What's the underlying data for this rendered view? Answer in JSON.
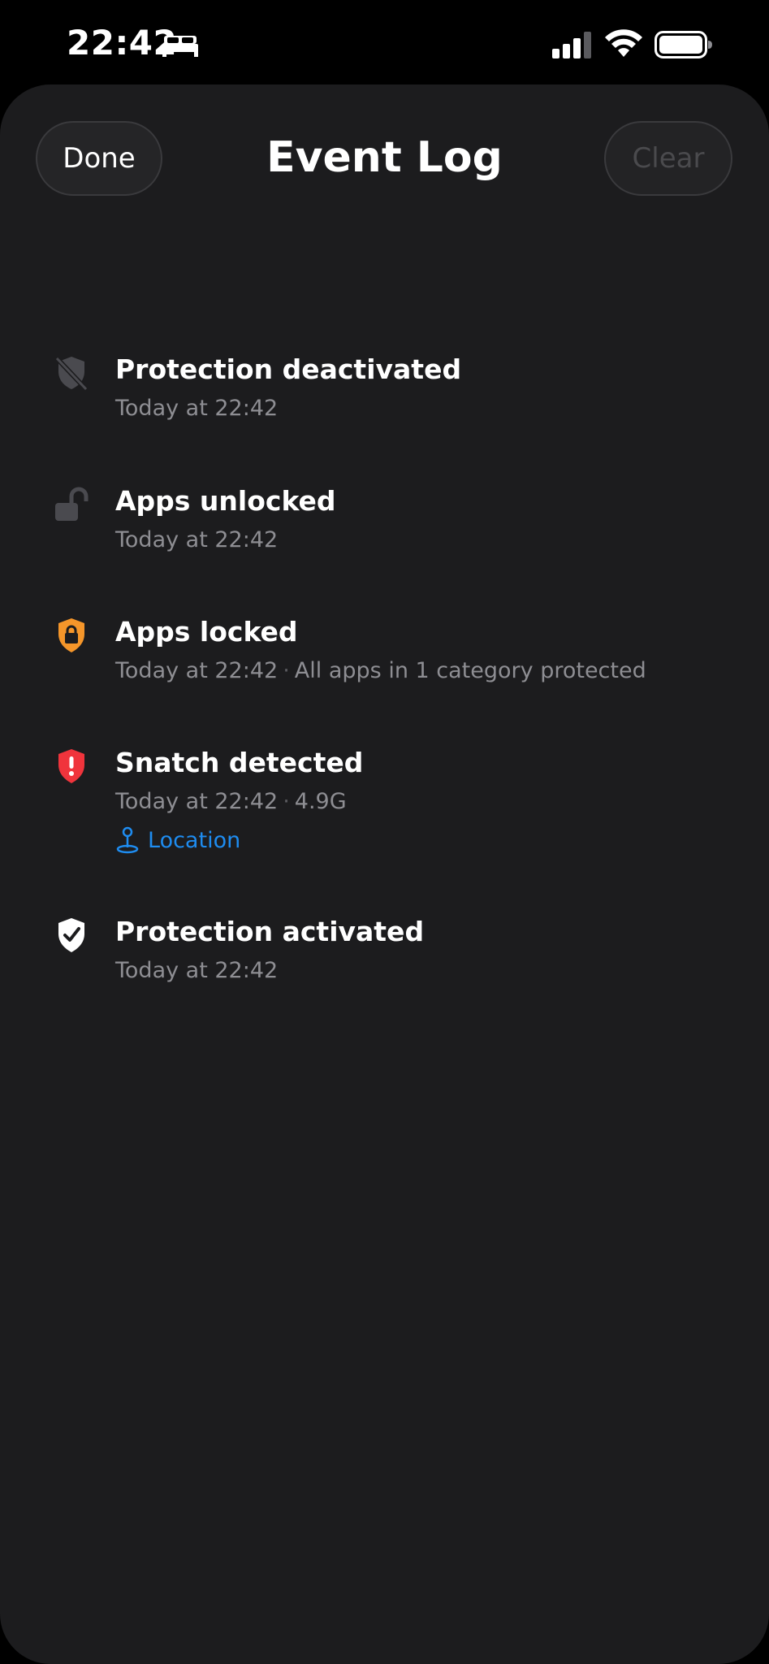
{
  "status_bar": {
    "time": "22:42",
    "focus_icon": "bed-icon",
    "signal_icon": "cellular-signal-icon",
    "wifi_icon": "wifi-icon",
    "battery_icon": "battery-icon"
  },
  "nav": {
    "done_label": "Done",
    "title": "Event Log",
    "clear_label": "Clear"
  },
  "events": [
    {
      "title": "Protection deactivated",
      "time": "Today at 22:42",
      "detail": "",
      "icon": "shield-slash-icon",
      "icon_color": "#5a5a5f"
    },
    {
      "title": "Apps unlocked",
      "time": "Today at 22:42",
      "detail": "",
      "icon": "unlocked-padlock-icon",
      "icon_color": "#5a5a5f"
    },
    {
      "title": "Apps locked",
      "time": "Today at 22:42",
      "detail": "All apps in 1 category protected",
      "icon": "shield-lock-icon",
      "icon_color": "#f5962a"
    },
    {
      "title": "Snatch detected",
      "time": "Today at 22:42",
      "detail": "4.9G",
      "icon": "shield-alert-icon",
      "icon_color": "#f0343c",
      "link": "Location",
      "link_icon": "location-pin-icon",
      "link_color": "#1e8cf0"
    },
    {
      "title": "Protection activated",
      "time": "Today at 22:42",
      "detail": "",
      "icon": "shield-check-icon",
      "icon_color": "#ffffff"
    }
  ],
  "colors": {
    "background": "#000000",
    "sheet": "#1c1c1e",
    "secondary_text": "#8e8e93",
    "disabled_text": "#4a4a4d"
  }
}
